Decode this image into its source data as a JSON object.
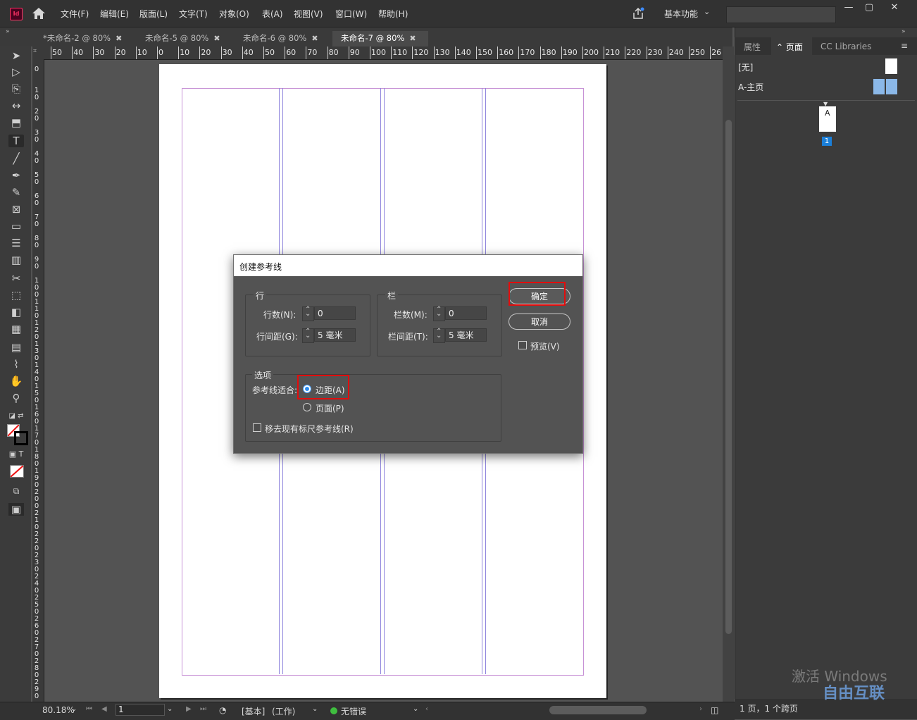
{
  "menubar": {
    "items": [
      "文件(F)",
      "编辑(E)",
      "版面(L)",
      "文字(T)",
      "对象(O)",
      "表(A)",
      "视图(V)",
      "窗口(W)",
      "帮助(H)"
    ],
    "workspace": "基本功能",
    "search_placeholder": ""
  },
  "tabs": [
    {
      "label": "*未命名-2 @ 80%"
    },
    {
      "label": "未命名-5 @ 80%"
    },
    {
      "label": "未命名-6 @ 80%"
    },
    {
      "label": "未命名-7 @ 80%",
      "active": true
    }
  ],
  "ruler": {
    "h_labels": [
      "50",
      "40",
      "30",
      "20",
      "10",
      "0",
      "10",
      "20",
      "30",
      "40",
      "50",
      "60",
      "70",
      "80",
      "90",
      "100",
      "110",
      "120",
      "130",
      "140",
      "150",
      "160",
      "170",
      "180",
      "190",
      "200",
      "210",
      "220",
      "230",
      "240",
      "250",
      "26"
    ],
    "v_labels": [
      "0",
      "10",
      "20",
      "30",
      "40",
      "50",
      "60",
      "70",
      "80",
      "90",
      "100",
      "110",
      "120",
      "130",
      "140",
      "150",
      "160",
      "170",
      "180",
      "190",
      "200",
      "210",
      "220",
      "230",
      "240",
      "250",
      "260",
      "270",
      "280",
      "290"
    ]
  },
  "right_panel": {
    "tabs": [
      "属性",
      "页面",
      "CC Libraries"
    ],
    "active_tab": "页面",
    "masters": [
      "[无]",
      "A-主页"
    ],
    "page_thumb_letter": "A",
    "page_number": "1",
    "footer": "1 页，1 个跨页"
  },
  "status": {
    "zoom": "80.18%",
    "page": "1",
    "master": "[基本]",
    "mode": "(工作)",
    "preflight": "无错误"
  },
  "dialog": {
    "title": "创建参考线",
    "rows_group": "行",
    "rows_count_label": "行数(N):",
    "rows_count_value": "0",
    "rows_gutter_label": "行间距(G):",
    "rows_gutter_value": "5 毫米",
    "cols_group": "栏",
    "cols_count_label": "栏数(M):",
    "cols_count_value": "0",
    "cols_gutter_label": "栏间距(T):",
    "cols_gutter_value": "5 毫米",
    "ok": "确定",
    "cancel": "取消",
    "preview": "预览(V)",
    "options_group": "选项",
    "fit_label": "参考线适合:",
    "fit_margin": "边距(A)",
    "fit_page": "页面(P)",
    "remove_existing": "移去现有标尺参考线(R)",
    "fit_selected": "边距(A)"
  },
  "watermark": {
    "activate": "激活 Windows",
    "logo": "自由互联"
  },
  "colors": {
    "accent_red": "#e20d0d",
    "guide_column": "#8f85dd",
    "guide_margin": "#c792d6",
    "radio_blue": "#2b8cf0"
  }
}
